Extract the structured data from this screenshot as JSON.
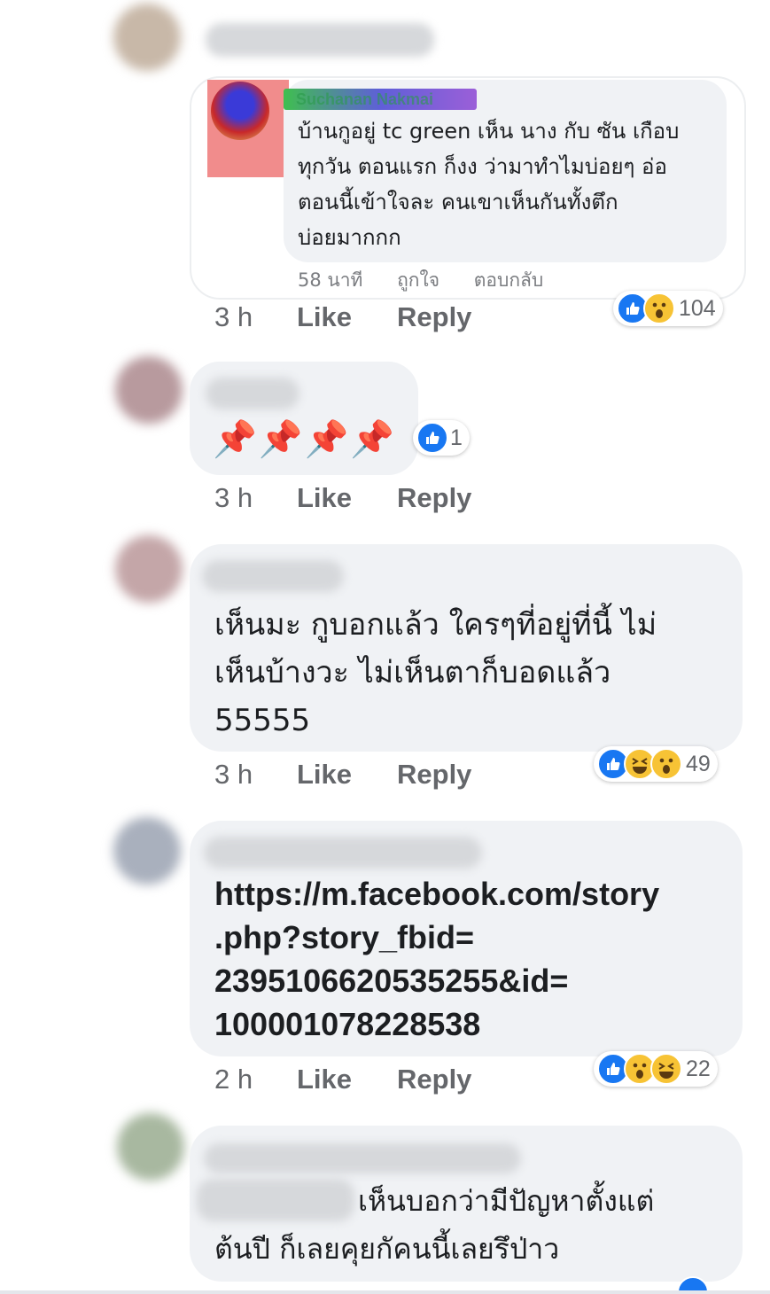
{
  "comments": [
    {
      "embedded_screenshot": {
        "author": "Suchanan Nakmai",
        "text": "บ้านกูอยู่ tc green เห็น นาง กับ ซัน เกือบ\nทุกวัน ตอนแรก ก็งง ว่ามาทำไมบ่อยๆ อ่อ\nตอนนี้เข้าใจละ คนเขาเห็นกันทั้งตึก\nบ่อยมากกก",
        "time": "58 นาที",
        "like": "ถูกใจ",
        "reply": "ตอบกลับ"
      },
      "time": "3 h",
      "like": "Like",
      "reply": "Reply",
      "reaction_count": "104",
      "reactions": [
        "like-icon",
        "wow-icon"
      ]
    },
    {
      "text": "📌📌📌📌",
      "time": "3 h",
      "like": "Like",
      "reply": "Reply",
      "reaction_count": "1",
      "reactions": [
        "like-icon"
      ]
    },
    {
      "text": "เห็นมะ กูบอกแล้ว ใครๆที่อยู่ที่นี้ ไม่\nเห็นบ้างวะ ไม่เห็นตาก็บอดแล้ว\n55555",
      "time": "3 h",
      "like": "Like",
      "reply": "Reply",
      "reaction_count": "49",
      "reactions": [
        "like-icon",
        "haha-icon",
        "wow-icon"
      ]
    },
    {
      "text": "https://m.facebook.com/story\n.php?story_fbid=\n2395106620535255&id=\n100001078228538",
      "time": "2 h",
      "like": "Like",
      "reply": "Reply",
      "reaction_count": "22",
      "reactions": [
        "like-icon",
        "wow-icon",
        "haha-icon"
      ]
    },
    {
      "text_line1": "เห็นบอกว่ามีปัญหาตั้งแต่",
      "text_line2": "ต้นปี ก็เลยคุยกัคนนี้เลยรึป่าว",
      "reactions": [
        "like-icon"
      ]
    }
  ],
  "colors": {
    "bubble": "#f0f2f5",
    "meta": "#65676b",
    "like_blue": "#1877f2",
    "emoji_yellow": "#f7c335"
  }
}
